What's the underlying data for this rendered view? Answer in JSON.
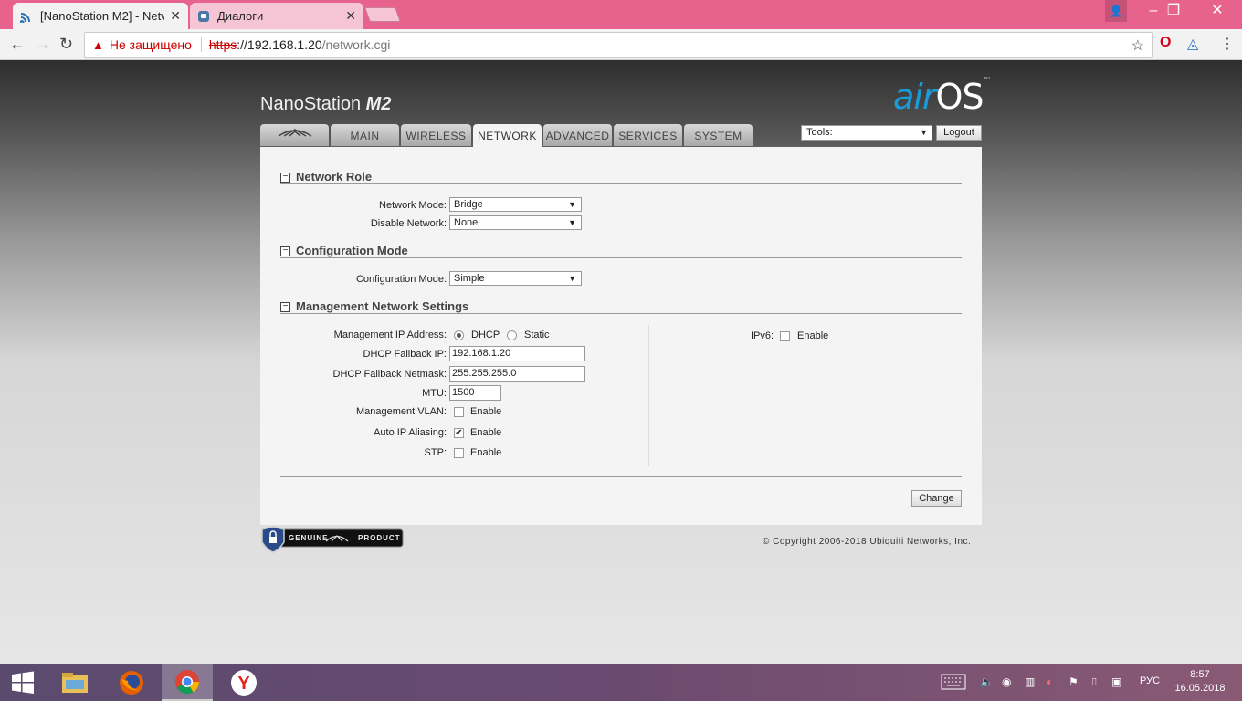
{
  "browser": {
    "tabs": [
      {
        "title": "[NanoStation M2] - Netw",
        "icon": "wifi-icon",
        "active": true
      },
      {
        "title": "Диалоги",
        "icon": "chat-icon",
        "active": false
      }
    ],
    "url": {
      "security_label": "Не защищено",
      "scheme": "https",
      "host": "://192.168.1.20",
      "path": "/network.cgi"
    }
  },
  "page": {
    "brand_prefix": "NanoStation",
    "brand_model": "M2",
    "logo_air": "air",
    "logo_os": "OS",
    "logo_tm": "™",
    "nav_tabs": [
      {
        "label": "",
        "icon": "ubiquiti-logo-icon"
      },
      {
        "label": "MAIN"
      },
      {
        "label": "WIRELESS"
      },
      {
        "label": "NETWORK",
        "active": true
      },
      {
        "label": "ADVANCED"
      },
      {
        "label": "SERVICES"
      },
      {
        "label": "SYSTEM"
      }
    ],
    "tools_label": "Tools:",
    "logout_label": "Logout",
    "sections": {
      "network_role": "Network Role",
      "configuration_mode": "Configuration Mode",
      "management": "Management Network Settings"
    },
    "network_mode_label": "Network Mode:",
    "network_mode_value": "Bridge",
    "disable_network_label": "Disable Network:",
    "disable_network_value": "None",
    "config_mode_label": "Configuration Mode:",
    "config_mode_value": "Simple",
    "mgmt_ip_label": "Management IP Address:",
    "dhcp_label": "DHCP",
    "static_label": "Static",
    "fallback_ip_label": "DHCP Fallback IP:",
    "fallback_ip_value": "192.168.1.20",
    "fallback_mask_label": "DHCP Fallback Netmask:",
    "fallback_mask_value": "255.255.255.0",
    "mtu_label": "MTU:",
    "mtu_value": "1500",
    "mgmt_vlan_label": "Management VLAN:",
    "auto_ip_label": "Auto IP Aliasing:",
    "stp_label": "STP:",
    "ipv6_label": "IPv6:",
    "enable_label": "Enable",
    "change_label": "Change",
    "genuine_text_1": "GENUINE",
    "genuine_text_2": "PRODUCT",
    "copyright": "© Copyright 2006-2018 Ubiquiti Networks, Inc."
  },
  "taskbar": {
    "language": "РУС",
    "time": "8:57",
    "date": "16.05.2018"
  },
  "colors": {
    "titlebar": "#e8628e",
    "logo_blue": "#1a9bd7"
  }
}
